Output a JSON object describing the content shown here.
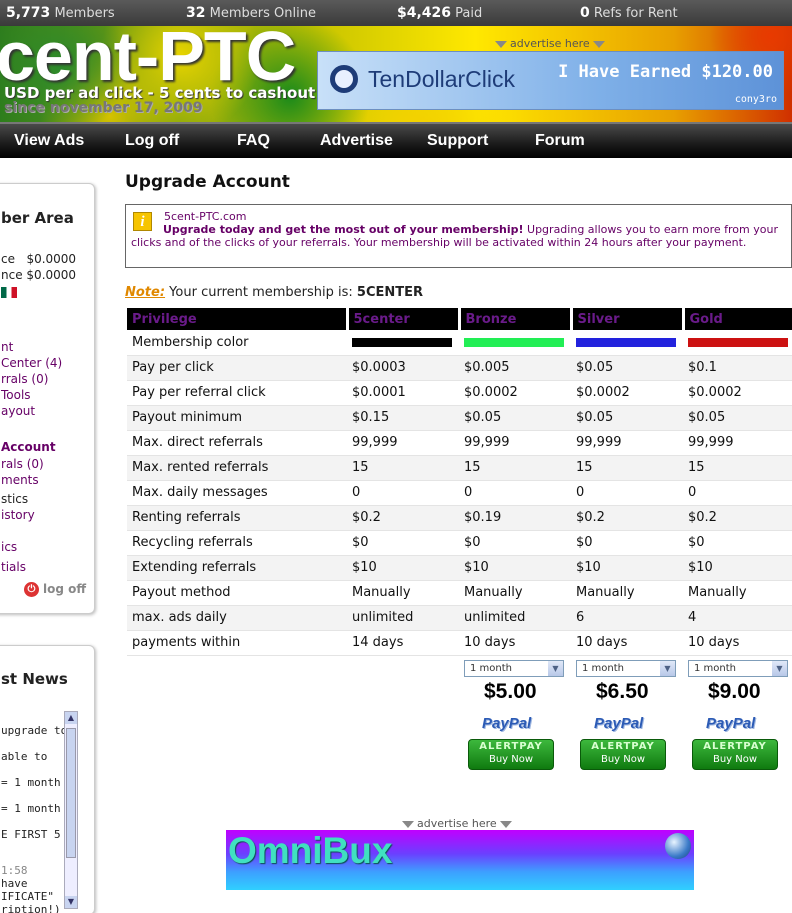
{
  "stats": {
    "members_count": "5,773",
    "members_label": "Members",
    "online_count": "32",
    "online_label": "Members Online",
    "paid_amount": "$4,426",
    "paid_label": "Paid",
    "refs_count": "0",
    "refs_label": "Refs for Rent"
  },
  "header": {
    "logo": "cent-PTC",
    "tagline": "USD per ad click - 5 cents to cashout",
    "since": "since november 17, 2009",
    "advertise_label": "advertise here",
    "banner": {
      "brand": "TenDollarClick",
      "earned": "I Have Earned $120.00",
      "user": "cony3ro"
    }
  },
  "nav": {
    "items": [
      "View Ads",
      "Log off",
      "FAQ",
      "Advertise",
      "Support",
      "Forum"
    ]
  },
  "sidebar": {
    "title": "ber Area",
    "balance1_label": "ce",
    "balance1_value": "$0.0000",
    "balance2_label": "nce",
    "balance2_value": "$0.0000",
    "links": [
      "nt",
      "Center (4)",
      "rrals (0)",
      " Tools",
      "ayout"
    ],
    "upgrade_link": "Account",
    "links2": [
      "rals (0)",
      "ments",
      "stics",
      "istory"
    ],
    "links3": [
      "ics",
      "tials"
    ],
    "logoff": "log off"
  },
  "news": {
    "title": "st News",
    "lines": [
      "upgrade to",
      "able to",
      "= 1 month",
      "= 1 month",
      "E FIRST 5",
      "1:58",
      " have",
      "IFICATE\"",
      "ription!)"
    ]
  },
  "main": {
    "title": "Upgrade Account",
    "info_site": "5cent-PTC.com",
    "info_bold": "Upgrade today and get the most out of your membership!",
    "info_text": " Upgrading allows you to earn more from your clicks and of the clicks of your referrals. Your membership will be activated within 24 hours after your payment.",
    "note": "Note:",
    "current_label": " Your current membership is: ",
    "current_level": "5CENTER"
  },
  "table": {
    "headers": [
      "Privilege",
      "5center",
      "Bronze",
      "Silver",
      "Gold"
    ],
    "colors_label": "Membership color",
    "colors": [
      "#000000",
      "#22ee55",
      "#2222dd",
      "#cc1111"
    ],
    "rows": [
      [
        "Pay per click",
        "$0.0003",
        "$0.005",
        "$0.05",
        "$0.1"
      ],
      [
        "Pay per referral click",
        "$0.0001",
        "$0.0002",
        "$0.0002",
        "$0.0002"
      ],
      [
        "Payout minimum",
        "$0.15",
        "$0.05",
        "$0.05",
        "$0.05"
      ],
      [
        "Max. direct referrals",
        "99,999",
        "99,999",
        "99,999",
        "99,999"
      ],
      [
        "Max. rented referrals",
        "15",
        "15",
        "15",
        "15"
      ],
      [
        "Max. daily messages",
        "0",
        "0",
        "0",
        "0"
      ],
      [
        "Renting referrals",
        "$0.2",
        "$0.19",
        "$0.2",
        "$0.2"
      ],
      [
        "Recycling referrals",
        "$0",
        "$0",
        "$0",
        "$0"
      ],
      [
        "Extending referrals",
        "$10",
        "$10",
        "$10",
        "$10"
      ],
      [
        "Payout method",
        "Manually",
        "Manually",
        "Manually",
        "Manually"
      ],
      [
        "max. ads daily",
        "unlimited",
        "unlimited",
        "6",
        "4"
      ],
      [
        "payments within",
        "14 days",
        "10 days",
        "10 days",
        "10 days"
      ]
    ]
  },
  "plans": [
    {
      "period": "1 month",
      "price": "$5.00"
    },
    {
      "period": "1 month",
      "price": "$6.50"
    },
    {
      "period": "1 month",
      "price": "$9.00"
    }
  ],
  "payment": {
    "paypal": "PayPal",
    "alertpay": "ALERTPAY",
    "buy_now": "Buy Now"
  },
  "footer_ad": {
    "advertise_label": "advertise here",
    "banner_text": "OmniBux"
  }
}
